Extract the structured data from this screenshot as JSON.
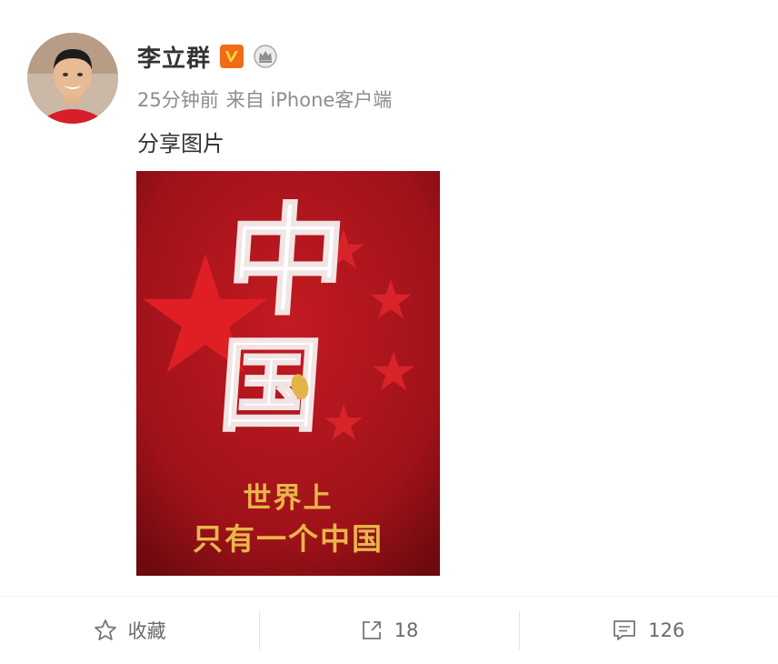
{
  "author": {
    "name": "李立群",
    "verified_icon": "verified-v-badge",
    "member_icon": "crown-badge"
  },
  "meta": {
    "time": "25分钟前",
    "source": "来自 iPhone客户端"
  },
  "post": {
    "text": "分享图片",
    "image": {
      "big_char_top": "中",
      "big_char_bottom": "国",
      "slogan_line1": "世界上",
      "slogan_line2": "只有一个中国"
    }
  },
  "actions": {
    "favorite_label": "收藏",
    "favorite_icon": "star-outline-icon",
    "repost_count": "18",
    "repost_icon": "share-arrow-icon",
    "comment_count": "126",
    "comment_icon": "comment-bubble-icon"
  },
  "colors": {
    "poster_red": "#b0141c",
    "star_red": "#e01f24",
    "slogan_gold": "#e8b54a",
    "verified_orange": "#f26b19"
  }
}
